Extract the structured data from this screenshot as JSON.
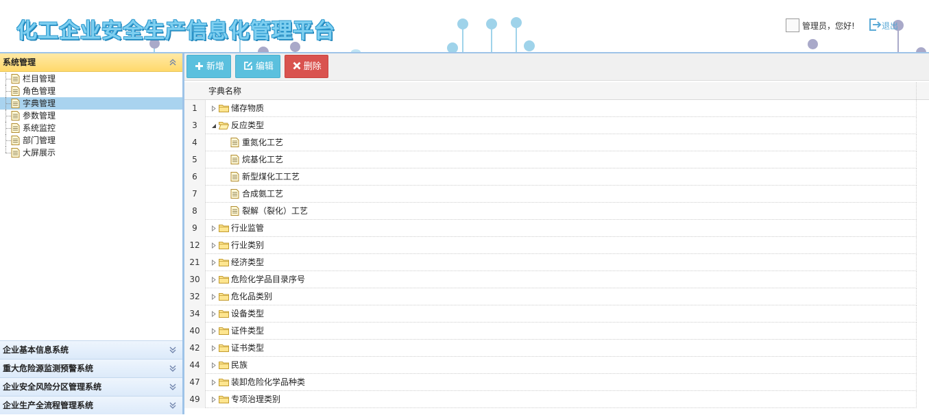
{
  "app": {
    "title": "化工企业安全生产信息化管理平台",
    "greeting": "管理员，您好!",
    "logout_label": "退出"
  },
  "sidebar": {
    "active_panel": "系统管理",
    "items": [
      {
        "label": "栏目管理",
        "selected": false
      },
      {
        "label": "角色管理",
        "selected": false
      },
      {
        "label": "字典管理",
        "selected": true
      },
      {
        "label": "参数管理",
        "selected": false
      },
      {
        "label": "系统监控",
        "selected": false
      },
      {
        "label": "部门管理",
        "selected": false
      },
      {
        "label": "大屏展示",
        "selected": false
      }
    ],
    "collapsed_panels": [
      "企业基本信息系统",
      "重大危险源监测预警系统",
      "企业安全风险分区管理系统",
      "企业生产全流程管理系统"
    ]
  },
  "toolbar": {
    "add_label": "新增",
    "edit_label": "编辑",
    "delete_label": "删除"
  },
  "grid": {
    "column_header": "字典名称",
    "rows": [
      {
        "num": "1",
        "label": "储存物质",
        "type": "folder",
        "level": 0,
        "expanded": false
      },
      {
        "num": "3",
        "label": "反应类型",
        "type": "folder",
        "level": 0,
        "expanded": true
      },
      {
        "num": "4",
        "label": "重氮化工艺",
        "type": "file",
        "level": 1
      },
      {
        "num": "5",
        "label": "烷基化工艺",
        "type": "file",
        "level": 1
      },
      {
        "num": "6",
        "label": "新型煤化工工艺",
        "type": "file",
        "level": 1
      },
      {
        "num": "7",
        "label": "合成氨工艺",
        "type": "file",
        "level": 1
      },
      {
        "num": "8",
        "label": "裂解（裂化）工艺",
        "type": "file",
        "level": 1
      },
      {
        "num": "9",
        "label": "行业监管",
        "type": "folder",
        "level": 0,
        "expanded": false
      },
      {
        "num": "12",
        "label": "行业类别",
        "type": "folder",
        "level": 0,
        "expanded": false
      },
      {
        "num": "21",
        "label": "经济类型",
        "type": "folder",
        "level": 0,
        "expanded": false
      },
      {
        "num": "30",
        "label": "危险化学品目录序号",
        "type": "folder",
        "level": 0,
        "expanded": false
      },
      {
        "num": "32",
        "label": "危化品类别",
        "type": "folder",
        "level": 0,
        "expanded": false
      },
      {
        "num": "34",
        "label": "设备类型",
        "type": "folder",
        "level": 0,
        "expanded": false
      },
      {
        "num": "40",
        "label": "证件类型",
        "type": "folder",
        "level": 0,
        "expanded": false
      },
      {
        "num": "42",
        "label": "证书类型",
        "type": "folder",
        "level": 0,
        "expanded": false
      },
      {
        "num": "44",
        "label": "民族",
        "type": "folder",
        "level": 0,
        "expanded": false
      },
      {
        "num": "47",
        "label": "装卸危险化学品种类",
        "type": "folder",
        "level": 0,
        "expanded": false
      },
      {
        "num": "49",
        "label": "专项治理类别",
        "type": "folder",
        "level": 0,
        "expanded": false
      }
    ]
  },
  "colors": {
    "accent_blue": "#5bc0de",
    "danger_red": "#d9534f",
    "active_panel_yellow": "#ffd96b",
    "selected_row": "#a9d3ef",
    "border_blue": "#9ec3e8"
  },
  "icons": {
    "add": "plus-icon",
    "edit": "edit-icon",
    "delete": "close-icon",
    "logout": "logout-icon",
    "tree_file": "document-icon",
    "tree_folder": "folder-icon"
  }
}
